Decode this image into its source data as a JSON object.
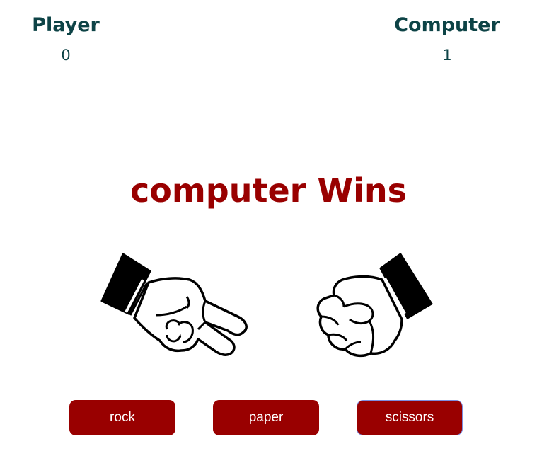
{
  "scoreboard": {
    "player": {
      "label": "Player",
      "score": "0"
    },
    "computer": {
      "label": "Computer",
      "score": "1"
    }
  },
  "result": {
    "text": "computer Wins"
  },
  "choices": {
    "player_choice_icon": "scissors-hand-icon",
    "computer_choice_icon": "rock-fist-icon"
  },
  "buttons": {
    "rock": "rock",
    "paper": "paper",
    "scissors": "scissors"
  },
  "colors": {
    "accent": "#990000",
    "score_text": "#0d4346",
    "button_text": "#ffffff"
  }
}
